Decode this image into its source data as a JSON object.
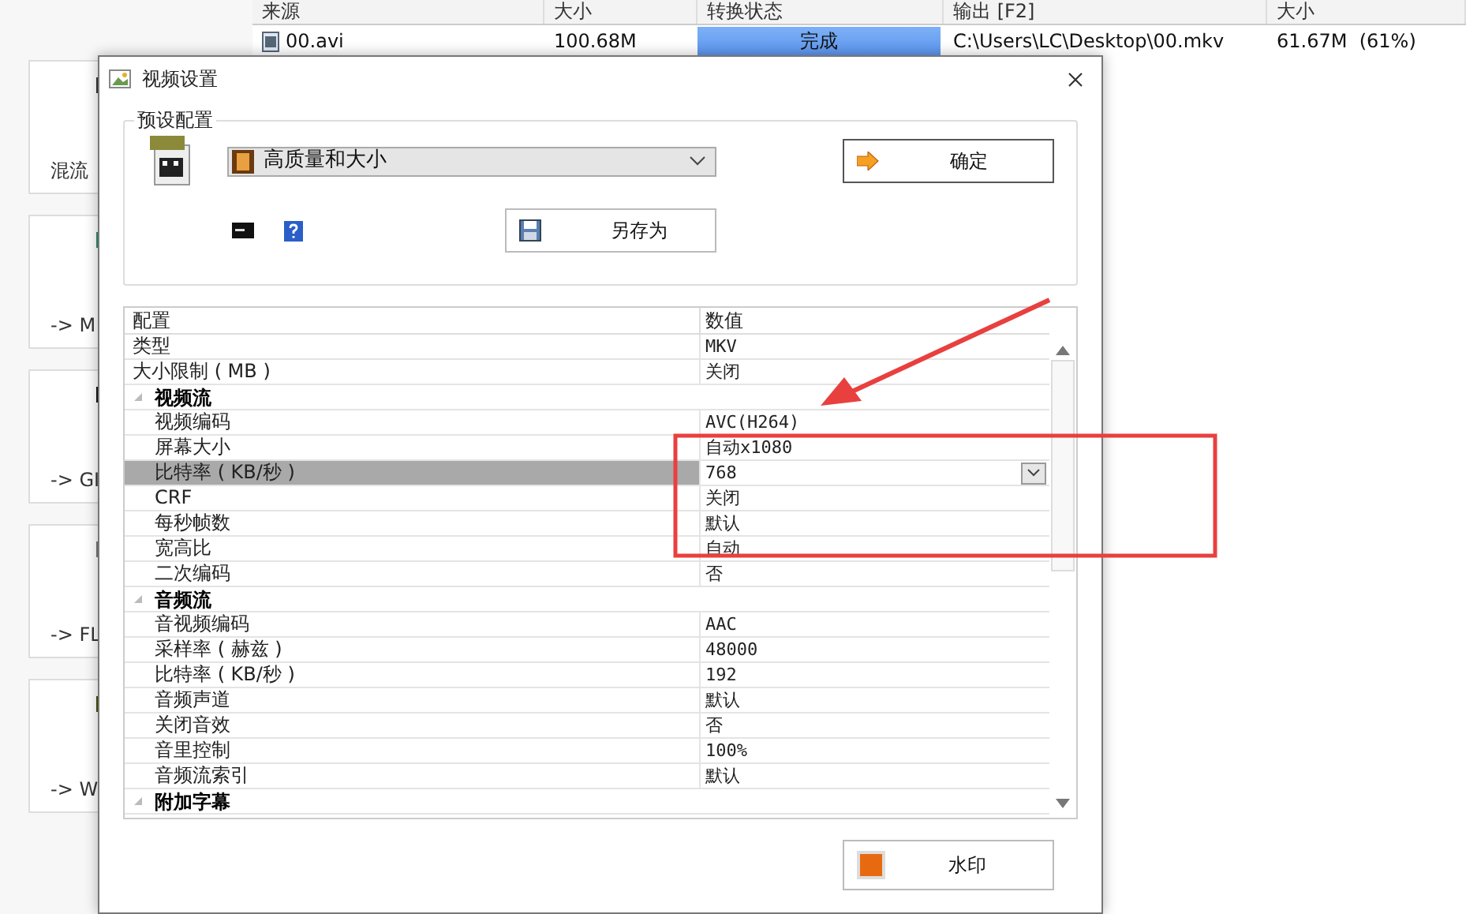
{
  "file_list": {
    "columns": [
      "来源",
      "大小",
      "转换状态",
      "输出 [F2]",
      "大小"
    ],
    "rows": [
      {
        "source": "00.avi",
        "size": "100.68M",
        "status": "完成",
        "level": 1,
        "output": "C:\\Users\\LC\\Desktop\\00.mkv",
        "output_size": "61.67M  (61%)"
      }
    ]
  },
  "tools": [
    {
      "label": "混流"
    },
    {
      "label": "-> M"
    },
    {
      "label": "-> GI"
    },
    {
      "label": "-> FL"
    },
    {
      "label": "-> W"
    }
  ],
  "dialog": {
    "title": "视频设置",
    "preset_group": {
      "title": "预设配置",
      "preset": "高质量和大小",
      "ok": "确定",
      "save_as": "另存为"
    },
    "grid": {
      "columns": [
        "配置",
        "数值"
      ],
      "rows": [
        {
          "kind": "item",
          "name": "类型",
          "value": "MKV",
          "selected": false
        },
        {
          "kind": "item",
          "name": "大小限制 ( MB )",
          "value": "关闭",
          "selected": false
        },
        {
          "kind": "category",
          "name": "视频流",
          "expanded": true,
          "children": [
            {
              "kind": "item",
              "name": "视频编码",
              "value": "AVC(H264)",
              "selected": false
            },
            {
              "kind": "item",
              "name": "屏幕大小",
              "value": "自动x1080",
              "selected": false
            },
            {
              "kind": "item",
              "name": "比特率 ( KB/秒 )",
              "value": "768",
              "selected": true
            },
            {
              "kind": "item",
              "name": "CRF",
              "value": "关闭",
              "selected": false
            },
            {
              "kind": "item",
              "name": "每秒帧数",
              "value": "默认",
              "selected": false
            },
            {
              "kind": "item",
              "name": "宽高比",
              "value": "自动",
              "selected": false
            },
            {
              "kind": "item",
              "name": "二次编码",
              "value": "否",
              "selected": false
            }
          ]
        },
        {
          "kind": "category",
          "name": "音频流",
          "expanded": true,
          "children": [
            {
              "kind": "item",
              "name": "音视频编码",
              "value": "AAC",
              "selected": false
            },
            {
              "kind": "item",
              "name": "采样率 ( 赫兹 )",
              "value": "48000",
              "selected": false
            },
            {
              "kind": "item",
              "name": "比特率 ( KB/秒 )",
              "value": "192",
              "selected": false
            },
            {
              "kind": "item",
              "name": "音频声道",
              "value": "默认",
              "selected": false
            },
            {
              "kind": "item",
              "name": "关闭音效",
              "value": "否",
              "selected": false
            },
            {
              "kind": "item",
              "name": "音里控制",
              "value": "100%",
              "selected": false
            },
            {
              "kind": "item",
              "name": "音频流索引",
              "value": "默认",
              "selected": false
            }
          ]
        },
        {
          "kind": "category",
          "name": "附加字幕",
          "expanded": true
        }
      ]
    },
    "watermark_button": "水印"
  }
}
